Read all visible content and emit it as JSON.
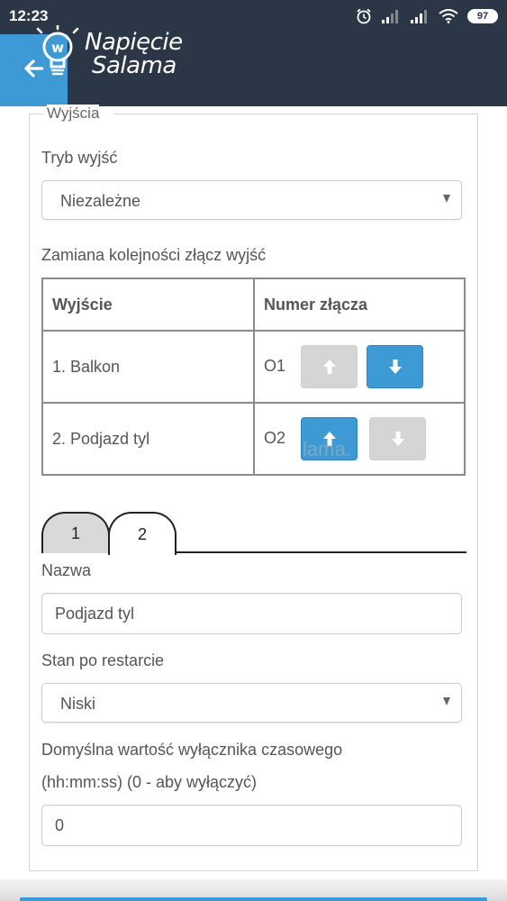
{
  "status_bar": {
    "time": "12:23",
    "battery": "97"
  },
  "header": {
    "logo_line1": "Napięcie",
    "logo_line2": "Salama"
  },
  "fieldset": {
    "legend": "Wyjścia"
  },
  "output_mode": {
    "label": "Tryb wyjść",
    "value": "Niezależne"
  },
  "swap": {
    "label": "Zamiana kolejności złącz wyjść",
    "headers": [
      "Wyjście",
      "Numer złącza"
    ],
    "rows": [
      {
        "output": "1. Balkon",
        "connector": "O1"
      },
      {
        "output": "2. Podjazd tyl",
        "connector": "O2"
      }
    ]
  },
  "watermark": "lama.",
  "tabs": [
    {
      "label": "1"
    },
    {
      "label": "2"
    }
  ],
  "form": {
    "name_label": "Nazwa",
    "name_value": "Podjazd tyl",
    "restart_label": "Stan po restarcie",
    "restart_value": "Niski",
    "timer_label_1": "Domyślna wartość wyłącznika czasowego",
    "timer_label_2": "(hh:mm:ss) (0 - aby wyłączyć)",
    "timer_value": "0"
  },
  "colors": {
    "header_bg": "#2b3646",
    "accent": "#3e9ad4",
    "disabled": "#d5d5d5"
  }
}
